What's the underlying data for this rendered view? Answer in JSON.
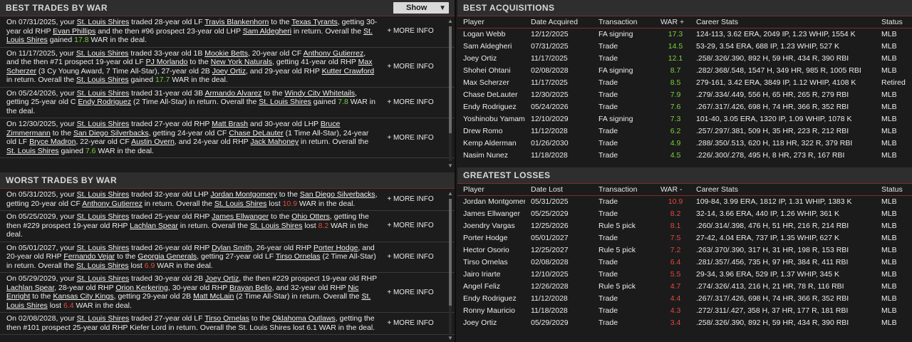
{
  "best_trades": {
    "title": "BEST TRADES BY WAR",
    "show_label": "Show",
    "more_label": "+ MORE INFO",
    "items": [
      {
        "parts": [
          [
            "t",
            "On 07/31/2025, your "
          ],
          [
            "u",
            "St. Louis Shires"
          ],
          [
            "t",
            " traded 28-year old LF "
          ],
          [
            "u",
            "Travis Blankenhorn"
          ],
          [
            "t",
            " to the "
          ],
          [
            "u",
            "Texas Tyrants"
          ],
          [
            "t",
            ", getting 30-year old RHP "
          ],
          [
            "u",
            "Evan Phillips"
          ],
          [
            "t",
            " and the then #96 prospect 23-year old LHP "
          ],
          [
            "u",
            "Sam Aldegheri"
          ],
          [
            "t",
            " in return. Overall the "
          ],
          [
            "u",
            "St. Louis Shires"
          ],
          [
            "t",
            " gained "
          ],
          [
            "g",
            "17.8"
          ],
          [
            "t",
            " WAR in the deal."
          ]
        ]
      },
      {
        "parts": [
          [
            "t",
            "On 11/17/2025, your "
          ],
          [
            "u",
            "St. Louis Shires"
          ],
          [
            "t",
            " traded 33-year old 1B "
          ],
          [
            "u",
            "Mookie Betts"
          ],
          [
            "t",
            ", 20-year old CF "
          ],
          [
            "u",
            "Anthony Gutierrez"
          ],
          [
            "t",
            ", and the then #71 prospect 19-year old LF "
          ],
          [
            "u",
            "PJ Morlando"
          ],
          [
            "t",
            " to the "
          ],
          [
            "u",
            "New York Naturals"
          ],
          [
            "t",
            ", getting 41-year old RHP "
          ],
          [
            "u",
            "Max Scherzer"
          ],
          [
            "t",
            " (3 Cy Young Award, 7 Time All-Star), 27-year old 2B "
          ],
          [
            "u",
            "Joey Ortiz"
          ],
          [
            "t",
            ", and 29-year old RHP "
          ],
          [
            "u",
            "Kutter Crawford"
          ],
          [
            "t",
            " in return. Overall the "
          ],
          [
            "u",
            "St. Louis Shires"
          ],
          [
            "t",
            " gained "
          ],
          [
            "g",
            "17.7"
          ],
          [
            "t",
            " WAR in the deal."
          ]
        ]
      },
      {
        "parts": [
          [
            "t",
            "On 05/24/2026, your "
          ],
          [
            "u",
            "St. Louis Shires"
          ],
          [
            "t",
            " traded 31-year old 3B "
          ],
          [
            "u",
            "Armando Alvarez"
          ],
          [
            "t",
            " to the "
          ],
          [
            "u",
            "Windy City Whitetails"
          ],
          [
            "t",
            ", getting 25-year old C "
          ],
          [
            "u",
            "Endy Rodriguez"
          ],
          [
            "t",
            " (2 Time All-Star) in return. Overall the "
          ],
          [
            "u",
            "St. Louis Shires"
          ],
          [
            "t",
            " gained "
          ],
          [
            "g",
            "7.8"
          ],
          [
            "t",
            " WAR in the deal."
          ]
        ]
      },
      {
        "parts": [
          [
            "t",
            "On 12/30/2025, your "
          ],
          [
            "u",
            "St. Louis Shires"
          ],
          [
            "t",
            " traded 27-year old RHP "
          ],
          [
            "u",
            "Matt Brash"
          ],
          [
            "t",
            " and 30-year old LHP "
          ],
          [
            "u",
            "Bruce Zimmermann"
          ],
          [
            "t",
            " to the "
          ],
          [
            "u",
            "San Diego Silverbacks"
          ],
          [
            "t",
            ", getting 24-year old CF "
          ],
          [
            "u",
            "Chase DeLauter"
          ],
          [
            "t",
            " (1 Time All-Star), 24-year old LF "
          ],
          [
            "u",
            "Bryce Madron"
          ],
          [
            "t",
            ", 22-year old CF "
          ],
          [
            "u",
            "Austin Overn"
          ],
          [
            "t",
            ", and 24-year old RHP "
          ],
          [
            "u",
            "Jack Mahoney"
          ],
          [
            "t",
            " in return. Overall the "
          ],
          [
            "u",
            "St. Louis Shires"
          ],
          [
            "t",
            " gained "
          ],
          [
            "g",
            "7.6"
          ],
          [
            "t",
            " WAR in the deal."
          ]
        ]
      }
    ]
  },
  "worst_trades": {
    "title": "WORST TRADES BY WAR",
    "more_label": "+ MORE INFO",
    "items": [
      {
        "parts": [
          [
            "t",
            "On 05/31/2025, your "
          ],
          [
            "u",
            "St. Louis Shires"
          ],
          [
            "t",
            " traded 32-year old LHP "
          ],
          [
            "u",
            "Jordan Montgomery"
          ],
          [
            "t",
            " to the "
          ],
          [
            "u",
            "San Diego Silverbacks"
          ],
          [
            "t",
            ", getting 20-year old CF "
          ],
          [
            "u",
            "Anthony Gutierrez"
          ],
          [
            "t",
            " in return. Overall the "
          ],
          [
            "u",
            "St. Louis Shires"
          ],
          [
            "t",
            " lost "
          ],
          [
            "r",
            "10.9"
          ],
          [
            "t",
            " WAR in the deal."
          ]
        ]
      },
      {
        "parts": [
          [
            "t",
            "On 05/25/2029, your "
          ],
          [
            "u",
            "St. Louis Shires"
          ],
          [
            "t",
            " traded 25-year old RHP "
          ],
          [
            "u",
            "James Ellwanger"
          ],
          [
            "t",
            " to the "
          ],
          [
            "u",
            "Ohio Otters"
          ],
          [
            "t",
            ", getting the then #229 prospect 19-year old RHP "
          ],
          [
            "u",
            "Lachlan Spear"
          ],
          [
            "t",
            " in return. Overall the "
          ],
          [
            "u",
            "St. Louis Shires"
          ],
          [
            "t",
            " lost "
          ],
          [
            "r",
            "8.2"
          ],
          [
            "t",
            " WAR in the deal."
          ]
        ]
      },
      {
        "parts": [
          [
            "t",
            "On 05/01/2027, your "
          ],
          [
            "u",
            "St. Louis Shires"
          ],
          [
            "t",
            " traded 26-year old RHP "
          ],
          [
            "u",
            "Dylan Smith"
          ],
          [
            "t",
            ", 26-year old RHP "
          ],
          [
            "u",
            "Porter Hodge"
          ],
          [
            "t",
            ", and 20-year old RHP "
          ],
          [
            "u",
            "Fernando Vejar"
          ],
          [
            "t",
            " to the "
          ],
          [
            "u",
            "Georgia Generals"
          ],
          [
            "t",
            ", getting 27-year old LF "
          ],
          [
            "u",
            "Tirso Ornelas"
          ],
          [
            "t",
            " (2 Time All-Star) in return. Overall the "
          ],
          [
            "u",
            "St. Louis Shires"
          ],
          [
            "t",
            " lost "
          ],
          [
            "r",
            "6.9"
          ],
          [
            "t",
            " WAR in the deal."
          ]
        ]
      },
      {
        "parts": [
          [
            "t",
            "On 05/29/2029, your "
          ],
          [
            "u",
            "St. Louis Shires"
          ],
          [
            "t",
            " traded 30-year old 2B "
          ],
          [
            "u",
            "Joey Ortiz"
          ],
          [
            "t",
            ", the then #229 prospect 19-year old RHP "
          ],
          [
            "u",
            "Lachlan Spear"
          ],
          [
            "t",
            ", 28-year old RHP "
          ],
          [
            "u",
            "Orion Kerkering"
          ],
          [
            "t",
            ", 30-year old RHP "
          ],
          [
            "u",
            "Brayan Bello"
          ],
          [
            "t",
            ", and 32-year old RHP "
          ],
          [
            "u",
            "Nic Enright"
          ],
          [
            "t",
            " to the "
          ],
          [
            "u",
            "Kansas City Kings"
          ],
          [
            "t",
            ", getting 29-year old 2B "
          ],
          [
            "u",
            "Matt McLain"
          ],
          [
            "t",
            " (2 Time All-Star) in return. Overall the "
          ],
          [
            "u",
            "St. Louis Shires"
          ],
          [
            "t",
            " lost "
          ],
          [
            "r",
            "6.4"
          ],
          [
            "t",
            " WAR in the deal."
          ]
        ]
      },
      {
        "parts": [
          [
            "t",
            "On 02/08/2028, your "
          ],
          [
            "u",
            "St. Louis Shires"
          ],
          [
            "t",
            " traded 27-year old LF "
          ],
          [
            "u",
            "Tirso Ornelas"
          ],
          [
            "t",
            " to the "
          ],
          [
            "u",
            "Oklahoma Outlaws"
          ],
          [
            "t",
            ", getting the then #101 prospect 25-year old RHP Kiefer Lord in return. Overall the St. Louis Shires lost 6.1 WAR in the deal."
          ]
        ]
      }
    ]
  },
  "acquisitions": {
    "title": "BEST ACQUISITIONS",
    "headers": [
      "Player",
      "Date Acquired",
      "Transaction",
      "WAR +",
      "Career Stats",
      "Status"
    ],
    "rows": [
      [
        "Logan Webb",
        "12/12/2025",
        "FA signing",
        "17.3",
        "124-113, 3.62 ERA, 2049 IP, 1.23 WHIP, 1554 K",
        "MLB"
      ],
      [
        "Sam Aldegheri",
        "07/31/2025",
        "Trade",
        "14.5",
        "53-29, 3.54 ERA, 688 IP, 1.23 WHIP, 527 K",
        "MLB"
      ],
      [
        "Joey Ortiz",
        "11/17/2025",
        "Trade",
        "12.1",
        ".258/.326/.390, 892 H, 59 HR, 434 R, 390 RBI",
        "MLB"
      ],
      [
        "Shohei Ohtani",
        "02/08/2028",
        "FA signing",
        "8.7",
        ".282/.368/.548, 1547 H, 349 HR, 985 R, 1005 RBI",
        "MLB"
      ],
      [
        "Max Scherzer",
        "11/17/2025",
        "Trade",
        "8.5",
        "279-161, 3.42 ERA, 3849 IP, 1.12 WHIP, 4108 K",
        "Retired"
      ],
      [
        "Chase DeLauter",
        "12/30/2025",
        "Trade",
        "7.9",
        ".279/.334/.449, 556 H, 65 HR, 265 R, 279 RBI",
        "MLB"
      ],
      [
        "Endy Rodriguez",
        "05/24/2026",
        "Trade",
        "7.6",
        ".267/.317/.426, 698 H, 74 HR, 366 R, 352 RBI",
        "MLB"
      ],
      [
        "Yoshinobu Yamamoto",
        "12/10/2029",
        "FA signing",
        "7.3",
        "101-40, 3.05 ERA, 1320 IP, 1.09 WHIP, 1078 K",
        "MLB"
      ],
      [
        "Drew Romo",
        "11/12/2028",
        "Trade",
        "6.2",
        ".257/.297/.381, 509 H, 35 HR, 223 R, 212 RBI",
        "MLB"
      ],
      [
        "Kemp Alderman",
        "01/26/2030",
        "Trade",
        "4.9",
        ".288/.350/.513, 620 H, 118 HR, 322 R, 379 RBI",
        "MLB"
      ],
      [
        "Nasim Nunez",
        "11/18/2028",
        "Trade",
        "4.5",
        ".226/.300/.278, 495 H, 8 HR, 273 R, 167 RBI",
        "MLB"
      ]
    ]
  },
  "losses": {
    "title": "GREATEST LOSSES",
    "headers": [
      "Player",
      "Date Lost",
      "Transaction",
      "WAR -",
      "Career Stats",
      "Status"
    ],
    "rows": [
      [
        "Jordan Montgomery",
        "05/31/2025",
        "Trade",
        "10.9",
        "109-84, 3.99 ERA, 1812 IP, 1.31 WHIP, 1383 K",
        "MLB"
      ],
      [
        "James Ellwanger",
        "05/25/2029",
        "Trade",
        "8.2",
        "32-14, 3.66 ERA, 440 IP, 1.26 WHIP, 361 K",
        "MLB"
      ],
      [
        "Joendry Vargas",
        "12/25/2026",
        "Rule 5 pick",
        "8.1",
        ".260/.314/.398, 476 H, 51 HR, 216 R, 214 RBI",
        "MLB"
      ],
      [
        "Porter Hodge",
        "05/01/2027",
        "Trade",
        "7.5",
        "27-42, 4.04 ERA, 737 IP, 1.35 WHIP, 627 K",
        "MLB"
      ],
      [
        "Hector Osorio",
        "12/25/2027",
        "Rule 5 pick",
        "7.2",
        ".263/.370/.390, 317 H, 31 HR, 198 R, 153 RBI",
        "MLB"
      ],
      [
        "Tirso Ornelas",
        "02/08/2028",
        "Trade",
        "6.4",
        ".281/.357/.456, 735 H, 97 HR, 384 R, 411 RBI",
        "MLB"
      ],
      [
        "Jairo Iriarte",
        "12/10/2025",
        "Trade",
        "5.5",
        "29-34, 3.96 ERA, 529 IP, 1.37 WHIP, 345 K",
        "MLB"
      ],
      [
        "Angel Feliz",
        "12/26/2028",
        "Rule 5 pick",
        "4.7",
        ".274/.326/.413, 216 H, 21 HR, 78 R, 116 RBI",
        "MLB"
      ],
      [
        "Endy Rodriguez",
        "11/12/2028",
        "Trade",
        "4.4",
        ".267/.317/.426, 698 H, 74 HR, 366 R, 352 RBI",
        "MLB"
      ],
      [
        "Ronny Mauricio",
        "11/18/2028",
        "Trade",
        "4.3",
        ".272/.311/.427, 358 H, 37 HR, 177 R, 181 RBI",
        "MLB"
      ],
      [
        "Joey Ortiz",
        "05/29/2029",
        "Trade",
        "3.4",
        ".258/.326/.390, 892 H, 59 HR, 434 R, 390 RBI",
        "MLB"
      ]
    ]
  },
  "colors": {
    "positive": "#7ad13c",
    "negative": "#e24b3c",
    "accent_line": "#7a2e2e"
  }
}
